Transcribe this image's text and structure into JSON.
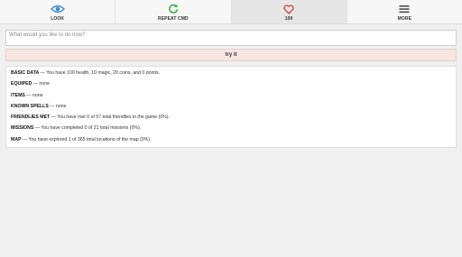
{
  "tabs": [
    {
      "label": "LOOK",
      "icon": "eye-icon",
      "color": "#3a8fd0"
    },
    {
      "label": "REPEAT CMD",
      "icon": "refresh-icon",
      "color": "#3aa84a"
    },
    {
      "label": "100",
      "icon": "heart-icon",
      "color": "#d0464a"
    },
    {
      "label": "MORE",
      "icon": "menu-icon",
      "color": "#444444"
    }
  ],
  "command": {
    "placeholder": "What would you like to do now?",
    "value": "",
    "button_label": "try it"
  },
  "status": {
    "basic_label": "BASIC DATA",
    "basic_text": " — You have 100 health, 10 magic, 20 coins, and 0 points.",
    "equiped_label": "EQUIPED",
    "equiped_text": " — none",
    "items_label": "ITEMS",
    "items_text": " — none",
    "spells_label": "KNOWN SPELLS",
    "spells_text": " — none",
    "friendlies_label": "FRIENDLIES MET",
    "friendlies_text": " — You have met 0 of 57 total friendlies in the game (0%).",
    "missions_label": "MISSIONS",
    "missions_text": " — You have completed 0 of 21 total missions (0%).",
    "map_label": "MAP",
    "map_text": " — You have explored 1 of 365 total locations of the map (0%)."
  }
}
